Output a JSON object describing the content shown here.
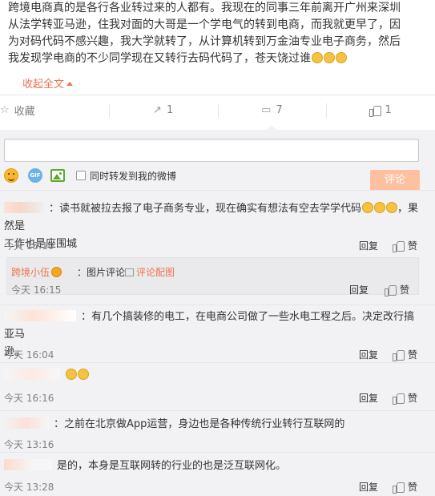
{
  "post": {
    "line1": "跨境电商真的是各行各业转过来的人都有。我现在的同事三年前离开广州来深圳",
    "line2": "从法学转亚马逊，住我对面的大哥是一个学电气的转到电商，而我就更早了，因",
    "line3": "为对码代码不感兴趣，我大学就转了，从计算机转到万金油专业电子商务，然后",
    "line4": "我发现学电商的不少同学现在又转行去码代码了，苍天饶过谁",
    "collapse": "收起全文"
  },
  "actions": [
    {
      "icon": "star-icon",
      "label": "收藏"
    },
    {
      "icon": "share-icon",
      "label": "1"
    },
    {
      "icon": "comment-icon",
      "label": "7"
    },
    {
      "icon": "like-icon",
      "label": "1"
    }
  ],
  "composer": {
    "input_value": "",
    "share_label": "同时转发到我的微博",
    "submit_label": "评论"
  },
  "comments": [
    {
      "line1": "：读书就被拉去报了电子商务专业，现在确实有想法有空去学学代码",
      "line1_end": "，果然是",
      "line2": "工作也是座围城",
      "time": "今天 15:10",
      "reply": "回复",
      "like": "赞"
    },
    {
      "sub_name": "跨境小伍",
      "sub_text": "：图片评论",
      "sub_link": "评论配图",
      "time": "今天 16:15",
      "reply": "回复",
      "like": "赞"
    },
    {
      "line1": "：有几个搞装修的电工，在电商公司做了一些水电工程之后。决定改行搞亚马",
      "line2": "逊。",
      "time": "今天 16:04",
      "reply": "回复",
      "like": "赞"
    },
    {
      "time": "今天 16:16",
      "reply": "回复",
      "like": "赞"
    },
    {
      "line1": "：之前在北京做App运营，身边也是各种传统行业转行互联网的",
      "time": "今天 13:16",
      "reply": "回复",
      "like": "赞"
    },
    {
      "line1": "是的，本身是互联网转的行业的也是泛互联网化。",
      "time": "今天 13:28",
      "reply": "回复",
      "like": "赞"
    }
  ],
  "colors": {
    "accent": "#eb7350",
    "submit_bg": "#ffc09f",
    "comment_bg": "#f2f2f5"
  }
}
